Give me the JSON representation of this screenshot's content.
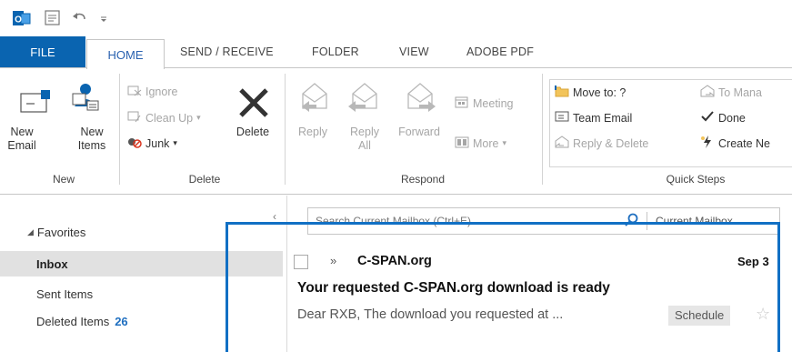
{
  "titlebar": {
    "icons": [
      "outlook-icon",
      "quick-access-icon",
      "undo-icon",
      "customize-toolbar-icon"
    ]
  },
  "tabs": [
    {
      "label": "FILE"
    },
    {
      "label": "HOME"
    },
    {
      "label": "SEND / RECEIVE"
    },
    {
      "label": "FOLDER"
    },
    {
      "label": "VIEW"
    },
    {
      "label": "ADOBE PDF"
    }
  ],
  "ribbon": {
    "new": {
      "new_email": "New Email",
      "new_items": "New Items",
      "group": "New"
    },
    "delete": {
      "ignore": "Ignore",
      "clean_up": "Clean Up",
      "junk": "Junk",
      "delete": "Delete",
      "group": "Delete"
    },
    "respond": {
      "reply": "Reply",
      "reply_all": "Reply All",
      "forward": "Forward",
      "meeting": "Meeting",
      "more": "More",
      "group": "Respond"
    },
    "quick_steps": {
      "move_to": "Move to: ?",
      "team_email": "Team Email",
      "reply_delete": "Reply & Delete",
      "to_manager": "To Mana",
      "done": "Done",
      "create_new": "Create Ne",
      "group": "Quick Steps"
    }
  },
  "nav": {
    "favorites": "Favorites",
    "inbox": "Inbox",
    "sent": "Sent Items",
    "deleted": "Deleted Items",
    "deleted_count": "26"
  },
  "search": {
    "placeholder": "Search Current Mailbox (Ctrl+E)",
    "scope": "Current Mailbox"
  },
  "message": {
    "sender": "C-SPAN.org",
    "date": "Sep 3",
    "subject": "Your requested C-SPAN.org download is ready",
    "preview": "Dear RXB,  The download you requested at ...",
    "tag": "Schedule"
  },
  "colors": {
    "file_tab": "#0a64b0",
    "home_tab_text": "#2a62b0",
    "highlight": "#1170c4",
    "count": "#1f6fc0"
  }
}
